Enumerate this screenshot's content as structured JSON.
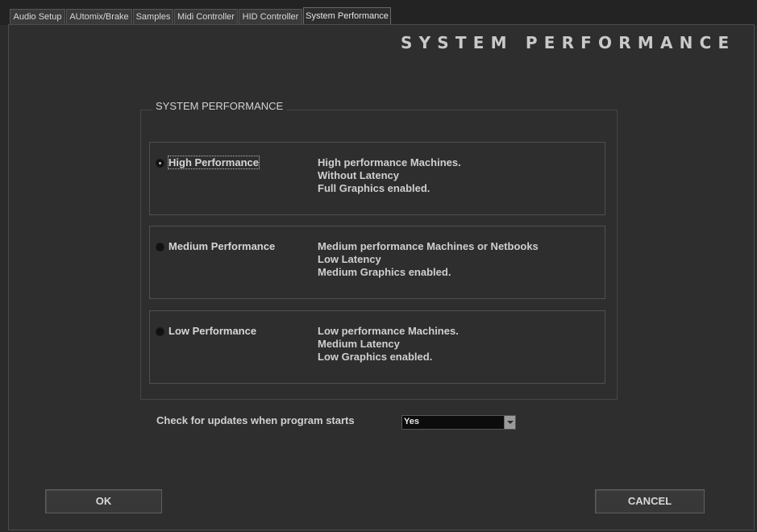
{
  "tabs": [
    {
      "label": "Audio Setup"
    },
    {
      "label": "AUtomix/Brake"
    },
    {
      "label": "Samples"
    },
    {
      "label": "Midi Controller"
    },
    {
      "label": "HID Controller"
    },
    {
      "label": "System Performance"
    }
  ],
  "header": {
    "title": "SYSTEM PERFORMANCE"
  },
  "group": {
    "label": "SYSTEM PERFORMANCE",
    "options": [
      {
        "label": "High Performance",
        "selected": true,
        "desc": [
          "High performance Machines.",
          "Without Latency",
          "Full Graphics enabled."
        ]
      },
      {
        "label": "Medium Performance",
        "selected": false,
        "desc": [
          "Medium performance Machines or Netbooks",
          "Low Latency",
          "Medium Graphics enabled."
        ]
      },
      {
        "label": "Low Performance",
        "selected": false,
        "desc": [
          "Low performance Machines.",
          "Medium Latency",
          "Low Graphics enabled."
        ]
      }
    ]
  },
  "updates": {
    "label": "Check for updates when program starts",
    "value": "Yes"
  },
  "buttons": {
    "ok": "OK",
    "cancel": "CANCEL"
  },
  "colors": {
    "background": "#2b2b2b",
    "text": "#d6d6d6",
    "border": "#505050"
  }
}
